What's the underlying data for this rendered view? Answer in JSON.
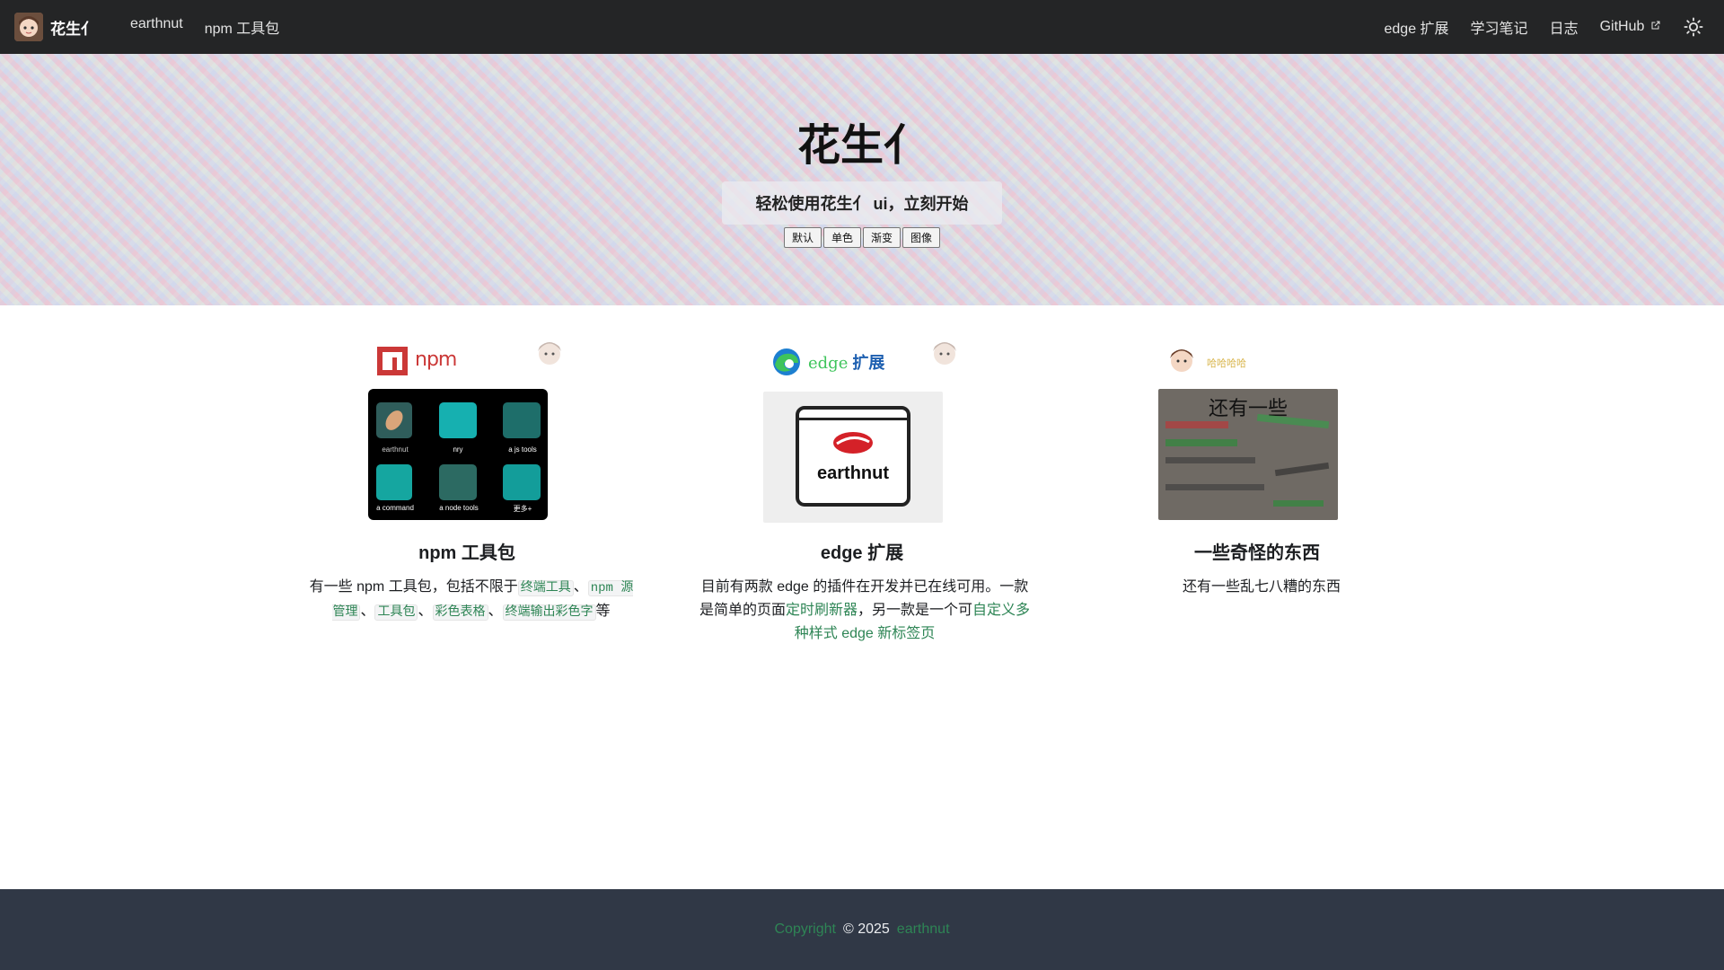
{
  "navbar": {
    "brand_title": "花生亻",
    "left_links": [
      "earthnut",
      "npm 工具包"
    ],
    "right_links": [
      "edge 扩展",
      "学习笔记",
      "日志"
    ],
    "github_label": "GitHub",
    "icons": {
      "brand": "avatar-logo",
      "external": "external-link-icon",
      "theme": "sun-icon"
    }
  },
  "hero": {
    "title": "花生亻",
    "subtitle": "轻松使用花生亻 ui，立刻开始",
    "buttons": [
      "默认",
      "单色",
      "渐变",
      "图像"
    ]
  },
  "features": [
    {
      "logo_text": "npm",
      "title": "npm 工具包",
      "desc_prefix": "有一些 npm 工具包，包括不限于",
      "desc_items": [
        "终端工具",
        "npm 源管理",
        "工具包",
        "彩色表格",
        "终端输出彩色字"
      ],
      "desc_sep": "、",
      "desc_suffix": "等",
      "image_labels": [
        "earthnut",
        "nry",
        "a js tools",
        "a command",
        "a node tools",
        "更多+"
      ]
    },
    {
      "logo_text": "edge 扩展",
      "title": "edge 扩展",
      "desc_prefix": "目前有两款 edge 的插件在开发并已在线可用。一款是简单的页面",
      "desc_link1": "定时刷新器",
      "desc_middle": "，另一款是一个可",
      "desc_link2": "自定义多种样式 edge 新标签页",
      "image_text": "earthnut"
    },
    {
      "logo_text": "哈哈哈哈",
      "title": "一些奇怪的东西",
      "desc": "还有一些乱七八糟的东西",
      "image_title": "还有一些"
    }
  ],
  "footer": {
    "copyright_label": "Copyright",
    "year_text": "© 2025",
    "author": "earthnut"
  },
  "colors": {
    "navbar_bg": "#242526",
    "accent": "#2e8555",
    "footer_bg": "#303846",
    "npm_red": "#cb3837"
  }
}
